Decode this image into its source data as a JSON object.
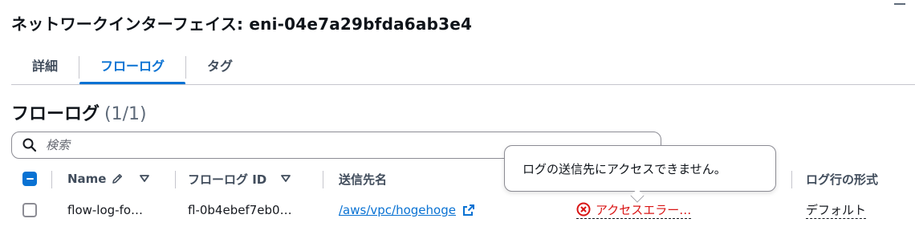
{
  "header": {
    "title": "ネットワークインターフェイス: eni-04e7a29bfda6ab3e4"
  },
  "tabs": [
    {
      "label": "詳細",
      "active": false
    },
    {
      "label": "フローログ",
      "active": true
    },
    {
      "label": "タグ",
      "active": false
    }
  ],
  "flow_logs": {
    "title": "フローログ",
    "count": "(1/1)",
    "search": {
      "placeholder": "検索",
      "value": ""
    },
    "columns": {
      "name": "Name",
      "flow_log_id": "フローログ ID",
      "destination": "送信先名",
      "log_line_format": "ログ行の形式"
    },
    "rows": [
      {
        "selected": false,
        "name": "flow-log-fo…",
        "flow_log_id": "fl-0b4ebef7eb0…",
        "destination": "/aws/vpc/hogehoge",
        "status": "アクセスエラー…",
        "log_line_format": "デフォルト"
      }
    ]
  },
  "tooltip": {
    "text": "ログの送信先にアクセスできません。"
  },
  "colors": {
    "accent": "#0972d3",
    "error": "#d91515",
    "text": "#16191f",
    "border": "#8c8c94"
  },
  "icons": [
    "menu-icon",
    "search-icon",
    "pencil-icon",
    "sort-icon",
    "external-link-icon",
    "error-circle-icon"
  ]
}
